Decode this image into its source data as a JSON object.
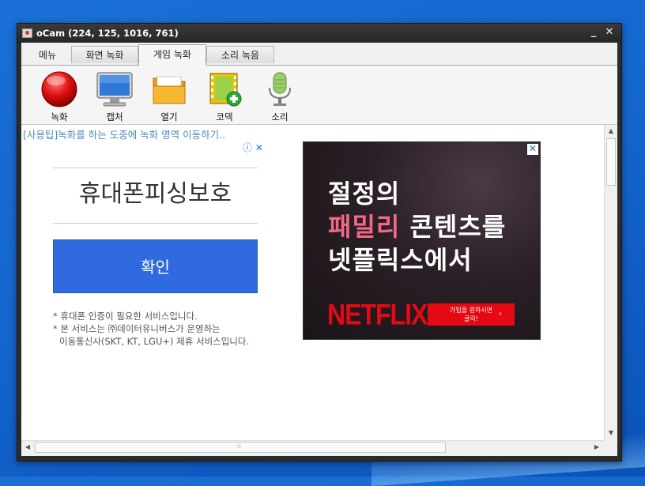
{
  "window": {
    "title": "oCam (224, 125, 1016, 761)",
    "minimize": "_",
    "close": "✕"
  },
  "tabs": [
    {
      "label": "메뉴"
    },
    {
      "label": "화면 녹화"
    },
    {
      "label": "게임 녹화"
    },
    {
      "label": "소리 녹음"
    }
  ],
  "active_tab": "게임 녹화",
  "toolbar": {
    "record_label": "녹화",
    "capture_label": "캡처",
    "open_label": "열기",
    "codec_label": "코덱",
    "sound_label": "소리"
  },
  "content": {
    "tip": "[사용팁]녹화를 하는 도중에 녹화 영역 이동하기..",
    "ad_left": {
      "info_icon": "ⓘ ✕",
      "headline": "휴대폰피싱보호",
      "button": "확인",
      "note1": "* 휴대폰 인증이 필요한 서비스입니다.",
      "note2": "* 본 서비스는 ㈜데이터유니버스가 운영하는",
      "note3": "이동통신사(SKT, KT, LGU+) 제휴 서비스입니다."
    },
    "ad_right": {
      "close_icon": "✕",
      "line1": "절정의",
      "line2_pink": "패밀리",
      "line2_rest": " 콘텐츠를",
      "line3": "넷플릭스에서",
      "brand": "NETFLIX",
      "cta_line1": "가입을 원하시면",
      "cta_line2": "클릭!",
      "cta_arrow": "›"
    }
  },
  "scrollbar": {
    "up": "▲",
    "down": "▼",
    "left": "◀",
    "right": "▶",
    "grip": "⦙⦙⦙"
  },
  "colors": {
    "accent": "#2f6bde",
    "netflix_red": "#e50914",
    "tip_blue": "#4a8cc9"
  }
}
